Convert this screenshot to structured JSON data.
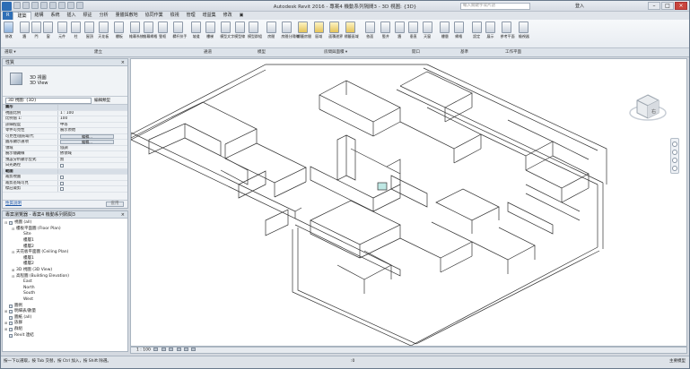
{
  "window": {
    "title": "Autodesk Revit 2016 -   專案4 機動系列隔間3 - 3D 視圖: {3D}",
    "search_placeholder": "輸入關鍵字或片語",
    "login": "登入",
    "minimize": "–",
    "maximize": "□",
    "close": "×"
  },
  "tabs": [
    "R",
    "建築",
    "結構",
    "系統",
    "插入",
    "標註",
    "分析",
    "量體與敷地",
    "協同作業",
    "檢視",
    "管理",
    "增益集",
    "修改",
    "▣"
  ],
  "active_tab": "建築",
  "ribbon_tools": [
    {
      "label": "修改",
      "style": "blue"
    },
    {
      "label": "牆",
      "style": ""
    },
    {
      "label": "門",
      "style": ""
    },
    {
      "label": "窗",
      "style": ""
    },
    {
      "label": "元件",
      "style": ""
    },
    {
      "label": "柱",
      "style": ""
    },
    {
      "label": "屋頂",
      "style": ""
    },
    {
      "label": "天花板",
      "style": ""
    },
    {
      "label": "樓板",
      "style": ""
    },
    {
      "label": "帷幕系統",
      "style": ""
    },
    {
      "label": "帷幕網格",
      "style": ""
    },
    {
      "label": "豎框",
      "style": ""
    },
    {
      "label": "欄杆扶手",
      "style": ""
    },
    {
      "label": "坡道",
      "style": ""
    },
    {
      "label": "樓梯",
      "style": ""
    },
    {
      "label": "模型文字",
      "style": ""
    },
    {
      "label": "模型線",
      "style": ""
    },
    {
      "label": "模型群組",
      "style": ""
    },
    {
      "label": "房間",
      "style": ""
    },
    {
      "label": "房間分隔線",
      "style": ""
    },
    {
      "label": "標籤房間",
      "style": "yel"
    },
    {
      "label": "區域",
      "style": "yel"
    },
    {
      "label": "面積邊界",
      "style": "yel"
    },
    {
      "label": "標籤區域",
      "style": "yel"
    },
    {
      "label": "依面",
      "style": ""
    },
    {
      "label": "豎井",
      "style": ""
    },
    {
      "label": "牆",
      "style": ""
    },
    {
      "label": "垂直",
      "style": ""
    },
    {
      "label": "天窗",
      "style": ""
    },
    {
      "label": "樓層",
      "style": ""
    },
    {
      "label": "網格",
      "style": ""
    },
    {
      "label": "設定",
      "style": ""
    },
    {
      "label": "展示",
      "style": ""
    },
    {
      "label": "參考平面",
      "style": ""
    },
    {
      "label": "檢視器",
      "style": ""
    }
  ],
  "panel_labels": [
    "選取 ▾",
    "建立",
    "通道",
    "模型",
    "房間與面積 ▾",
    "開口",
    "基準",
    "工作平面"
  ],
  "properties": {
    "header": "性質",
    "close": "×",
    "type_name": "3D 視圖",
    "type_name2": "3D View",
    "selector": "3D 視圖: {3D}",
    "edit_type": "編輯類型",
    "rows": [
      {
        "k": "圖形",
        "v": "",
        "cat": true
      },
      {
        "k": "視圖比例",
        "v": "1 : 100"
      },
      {
        "k": "比例值 1:",
        "v": "100"
      },
      {
        "k": "詳細程度",
        "v": "中等"
      },
      {
        "k": "零件可見性",
        "v": "展示原始"
      },
      {
        "k": "可見性/圖形取代",
        "v": "編輯...",
        "btn": true
      },
      {
        "k": "圖形顯示選項",
        "v": "編輯...",
        "btn": true
      },
      {
        "k": "領域",
        "v": "協調"
      },
      {
        "k": "展示隱藏線",
        "v": "依領域"
      },
      {
        "k": "預設分析顯示型式",
        "v": "無"
      },
      {
        "k": "日光路徑",
        "v": "",
        "chk": true
      },
      {
        "k": "範圍",
        "v": "",
        "cat": true
      },
      {
        "k": "裁剪視圖",
        "v": "",
        "chk": true
      },
      {
        "k": "裁剪區域可見",
        "v": "",
        "chk": true
      },
      {
        "k": "標註裁剪",
        "v": "",
        "chk": true
      }
    ],
    "help": "性質說明",
    "apply": "套用"
  },
  "browser": {
    "header": "專案瀏覽器 - 專案4 機動系列隔間3",
    "close": "×",
    "items": [
      {
        "t": "⊟",
        "label": "視圖 (all)",
        "indent": 0,
        "icon": true
      },
      {
        "t": "⊟",
        "label": "樓板平面圖 (Floor Plan)",
        "indent": 1
      },
      {
        "t": "",
        "label": "Site",
        "indent": 2
      },
      {
        "t": "",
        "label": "樓層1",
        "indent": 2
      },
      {
        "t": "",
        "label": "樓層2",
        "indent": 2
      },
      {
        "t": "⊟",
        "label": "天花板平面圖 (Ceiling Plan)",
        "indent": 1
      },
      {
        "t": "",
        "label": "樓層1",
        "indent": 2
      },
      {
        "t": "",
        "label": "樓層2",
        "indent": 2
      },
      {
        "t": "⊞",
        "label": "3D 視圖 (3D View)",
        "indent": 1
      },
      {
        "t": "⊟",
        "label": "高程圖 (Building Elevation)",
        "indent": 1
      },
      {
        "t": "",
        "label": "East",
        "indent": 2
      },
      {
        "t": "",
        "label": "North",
        "indent": 2
      },
      {
        "t": "",
        "label": "South",
        "indent": 2
      },
      {
        "t": "",
        "label": "West",
        "indent": 2
      },
      {
        "t": "",
        "label": "圖例",
        "indent": 0,
        "icon": true
      },
      {
        "t": "⊞",
        "label": "明細表/數量",
        "indent": 0,
        "icon": true
      },
      {
        "t": "",
        "label": "圖紙 (all)",
        "indent": 0,
        "icon": true
      },
      {
        "t": "⊞",
        "label": "族群",
        "indent": 0,
        "icon": true
      },
      {
        "t": "⊞",
        "label": "群組",
        "indent": 0,
        "icon": true
      },
      {
        "t": "",
        "label": "Revit 連結",
        "indent": 0,
        "icon": true
      }
    ]
  },
  "viewbar": {
    "scale": "1 : 100"
  },
  "status": {
    "left": "按一下以選取，按 Tab 交替，按 Ctrl 加入，按 Shift 除選。",
    "mid": ":0",
    "right": "主要模型"
  },
  "viewcube": {
    "label": "右"
  },
  "colors": {
    "accent": "#2f6fb6",
    "viewport_bg": "#ffffff"
  }
}
